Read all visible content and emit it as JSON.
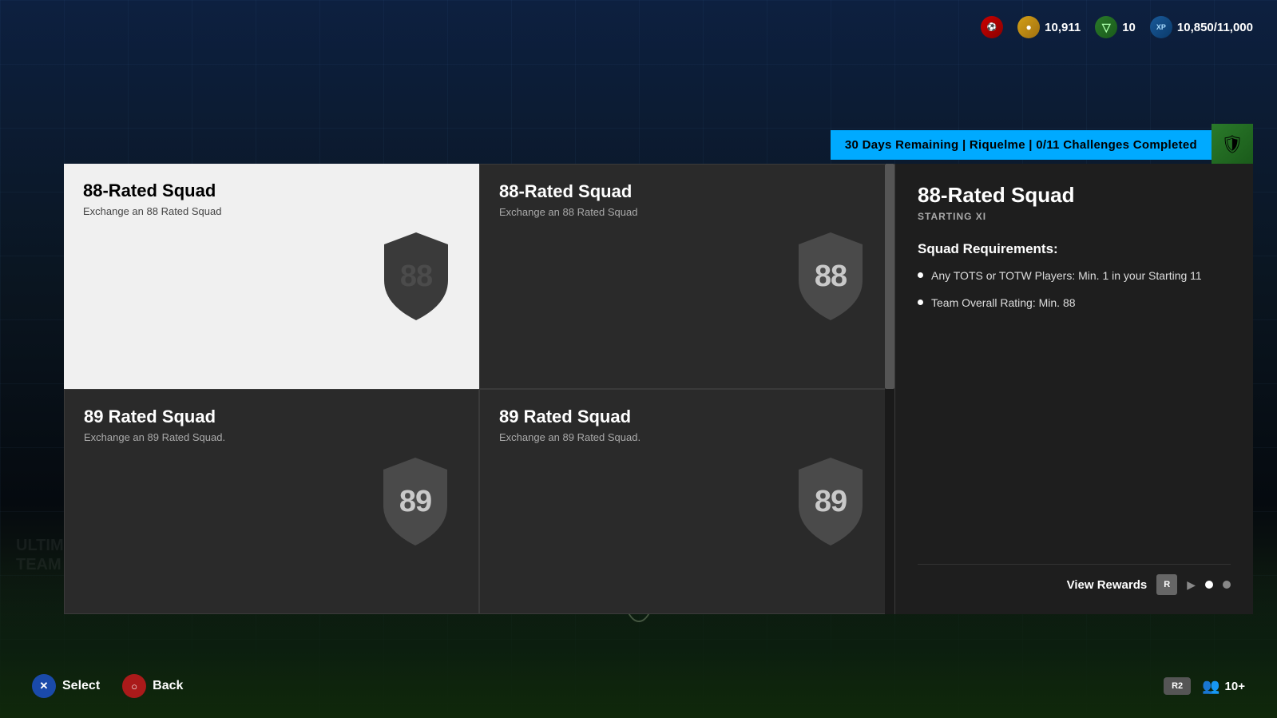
{
  "hud": {
    "club_icon": "⚽",
    "coins_label": "10,911",
    "shield_label": "10",
    "xp_label": "10,850/11,000"
  },
  "banner": {
    "text": "30 Days Remaining | Riquelme | 0/11 Challenges Completed",
    "icon": "🛡"
  },
  "squads": [
    {
      "id": "squad-88-1",
      "title": "88-Rated Squad",
      "desc": "Exchange an 88 Rated Squad",
      "rating": "88",
      "selected": true
    },
    {
      "id": "squad-88-2",
      "title": "88-Rated Squad",
      "desc": "Exchange an 88 Rated Squad",
      "rating": "88",
      "selected": false
    },
    {
      "id": "squad-89-1",
      "title": "89 Rated Squad",
      "desc": "Exchange an 89 Rated Squad.",
      "rating": "89",
      "selected": false
    },
    {
      "id": "squad-89-2",
      "title": "89 Rated Squad",
      "desc": "Exchange an 89 Rated Squad.",
      "rating": "89",
      "selected": false
    }
  ],
  "detail": {
    "title": "88-Rated Squad",
    "subtitle": "STARTING XI",
    "requirements_title": "Squad Requirements:",
    "requirements": [
      "Any TOTS or TOTW Players: Min. 1 in your Starting 11",
      "Team Overall Rating: Min. 88"
    ],
    "view_rewards_label": "View Rewards",
    "r_button": "R",
    "dots": [
      true,
      false,
      false
    ]
  },
  "bottom": {
    "select_label": "Select",
    "back_label": "Back",
    "r2_label": "R2",
    "players_label": "10+"
  }
}
